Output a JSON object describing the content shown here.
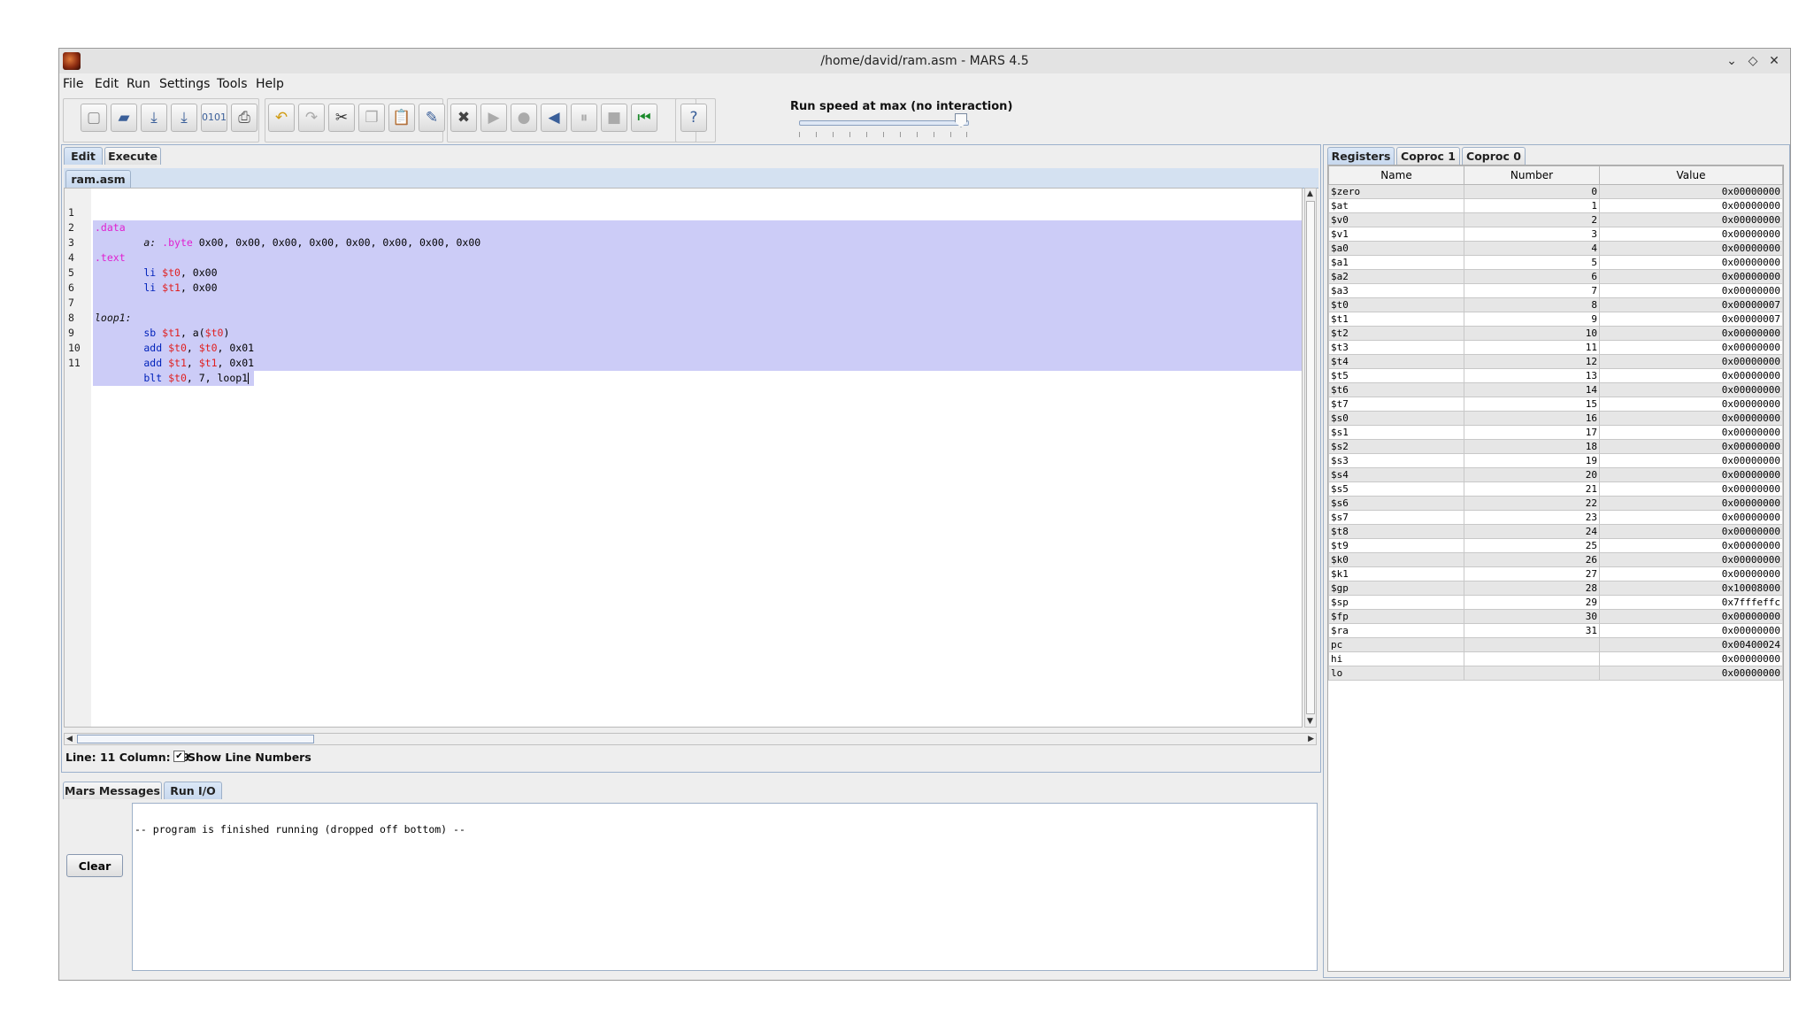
{
  "window": {
    "title": "/home/david/ram.asm - MARS 4.5"
  },
  "menu": [
    {
      "label": "File"
    },
    {
      "label": "Edit"
    },
    {
      "label": "Run"
    },
    {
      "label": "Settings"
    },
    {
      "label": "Tools"
    },
    {
      "label": "Help"
    }
  ],
  "toolbar": {
    "speed_label": "Run speed at max (no interaction)",
    "speed_fraction": 1.0,
    "buttons": [
      "new",
      "open",
      "save",
      "save-as",
      "dump-memory",
      "print",
      "undo",
      "redo",
      "cut",
      "copy",
      "paste",
      "find-replace",
      "assemble",
      "run",
      "step",
      "backstep",
      "pause",
      "stop",
      "reset",
      "help"
    ]
  },
  "edit_tabs": {
    "edit": "Edit",
    "execute": "Execute"
  },
  "file_tab": "ram.asm",
  "status": {
    "position": "Line: 11 Column: 19",
    "show_line_numbers": "Show Line Numbers",
    "checked": true
  },
  "code": [
    {
      "n": "1"
    },
    {
      "n": "2"
    },
    {
      "n": "3"
    },
    {
      "n": "4"
    },
    {
      "n": "5"
    },
    {
      "n": "6"
    },
    {
      "n": "7"
    },
    {
      "n": "8"
    },
    {
      "n": "9"
    },
    {
      "n": "10"
    },
    {
      "n": "11"
    }
  ],
  "code_text": {
    "l1": ".data",
    "l2a": "        a: ",
    "l2b": ".byte",
    "l2c": " 0x00, 0x00, 0x00, 0x00, 0x00, 0x00, 0x00, 0x00",
    "l3": ".text",
    "l4a": "        li ",
    "l4b": "$t0",
    "l4c": ", 0x00",
    "l5a": "        li ",
    "l5b": "$t1",
    "l5c": ", 0x00",
    "l7": "loop1:",
    "l8a": "        sb ",
    "l8b": "$t1",
    "l8c": ", a(",
    "l8d": "$t0",
    "l8e": ")",
    "l9a": "        add ",
    "l9b": "$t0",
    "l9c": ", ",
    "l9d": "$t0",
    "l9e": ", 0x01",
    "l10a": "        add ",
    "l10b": "$t1",
    "l10c": ", ",
    "l10d": "$t1",
    "l10e": ", 0x01",
    "l11a": "        blt ",
    "l11b": "$t0",
    "l11c": ", 7, loop1"
  },
  "messages": {
    "tab_mars": "Mars Messages",
    "tab_runio": "Run I/O",
    "output": "-- program is finished running (dropped off bottom) --",
    "clear": "Clear"
  },
  "registers": {
    "tabs": [
      "Registers",
      "Coproc 1",
      "Coproc 0"
    ],
    "headers": [
      "Name",
      "Number",
      "Value"
    ],
    "rows": [
      [
        "$zero",
        "0",
        "0x00000000"
      ],
      [
        "$at",
        "1",
        "0x00000000"
      ],
      [
        "$v0",
        "2",
        "0x00000000"
      ],
      [
        "$v1",
        "3",
        "0x00000000"
      ],
      [
        "$a0",
        "4",
        "0x00000000"
      ],
      [
        "$a1",
        "5",
        "0x00000000"
      ],
      [
        "$a2",
        "6",
        "0x00000000"
      ],
      [
        "$a3",
        "7",
        "0x00000000"
      ],
      [
        "$t0",
        "8",
        "0x00000007"
      ],
      [
        "$t1",
        "9",
        "0x00000007"
      ],
      [
        "$t2",
        "10",
        "0x00000000"
      ],
      [
        "$t3",
        "11",
        "0x00000000"
      ],
      [
        "$t4",
        "12",
        "0x00000000"
      ],
      [
        "$t5",
        "13",
        "0x00000000"
      ],
      [
        "$t6",
        "14",
        "0x00000000"
      ],
      [
        "$t7",
        "15",
        "0x00000000"
      ],
      [
        "$s0",
        "16",
        "0x00000000"
      ],
      [
        "$s1",
        "17",
        "0x00000000"
      ],
      [
        "$s2",
        "18",
        "0x00000000"
      ],
      [
        "$s3",
        "19",
        "0x00000000"
      ],
      [
        "$s4",
        "20",
        "0x00000000"
      ],
      [
        "$s5",
        "21",
        "0x00000000"
      ],
      [
        "$s6",
        "22",
        "0x00000000"
      ],
      [
        "$s7",
        "23",
        "0x00000000"
      ],
      [
        "$t8",
        "24",
        "0x00000000"
      ],
      [
        "$t9",
        "25",
        "0x00000000"
      ],
      [
        "$k0",
        "26",
        "0x00000000"
      ],
      [
        "$k1",
        "27",
        "0x00000000"
      ],
      [
        "$gp",
        "28",
        "0x10008000"
      ],
      [
        "$sp",
        "29",
        "0x7fffeffc"
      ],
      [
        "$fp",
        "30",
        "0x00000000"
      ],
      [
        "$ra",
        "31",
        "0x00000000"
      ],
      [
        "pc",
        "",
        "0x00400024"
      ],
      [
        "hi",
        "",
        "0x00000000"
      ],
      [
        "lo",
        "",
        "0x00000000"
      ]
    ]
  }
}
